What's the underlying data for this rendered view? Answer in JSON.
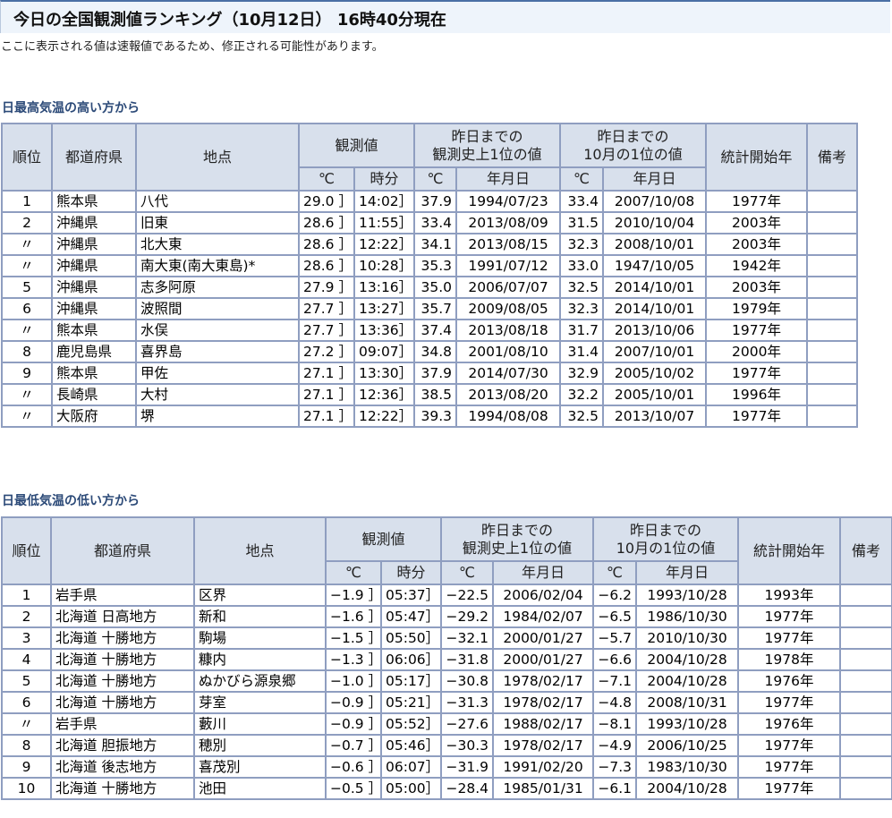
{
  "header": {
    "title": "今日の全国観測値ランキング（10月12日） 16時40分現在",
    "notice": "ここに表示される値は速報値であるため、修正される可能性があります。"
  },
  "columns": {
    "rank": "順位",
    "pref": "都道府県",
    "site": "地点",
    "obs": "観測値",
    "record_hist": "昨日まで の\n観測史上1位の値",
    "record_oct": "昨日まで の\n10月の1位の値",
    "stat_start": "統計開始年",
    "remarks": "備考",
    "celsius": "℃",
    "time": "時分",
    "date": "年月日"
  },
  "high": {
    "section_title": "日最高気温の高い方から",
    "rows": [
      [
        "1",
        "熊本県",
        "八代",
        "29.0 ］",
        "14:02］",
        "37.9",
        "1994/07/23",
        "33.4",
        "2007/10/08",
        "1977年",
        ""
      ],
      [
        "2",
        "沖縄県",
        "旧東",
        "28.6 ］",
        "11:55］",
        "33.4",
        "2013/08/09",
        "31.5",
        "2010/10/04",
        "2003年",
        ""
      ],
      [
        "〃",
        "沖縄県",
        "北大東",
        "28.6 ］",
        "12:22］",
        "34.1",
        "2013/08/15",
        "32.3",
        "2008/10/01",
        "2003年",
        ""
      ],
      [
        "〃",
        "沖縄県",
        "南大東(南大東島)*",
        "28.6 ］",
        "10:28］",
        "35.3",
        "1991/07/12",
        "33.0",
        "1947/10/05",
        "1942年",
        ""
      ],
      [
        "5",
        "沖縄県",
        "志多阿原",
        "27.9 ］",
        "13:16］",
        "35.0",
        "2006/07/07",
        "32.5",
        "2014/10/01",
        "2003年",
        ""
      ],
      [
        "6",
        "沖縄県",
        "波照間",
        "27.7 ］",
        "13:27］",
        "35.7",
        "2009/08/05",
        "32.3",
        "2014/10/01",
        "1979年",
        ""
      ],
      [
        "〃",
        "熊本県",
        "水俣",
        "27.7 ］",
        "13:36］",
        "37.4",
        "2013/08/18",
        "31.7",
        "2013/10/06",
        "1977年",
        ""
      ],
      [
        "8",
        "鹿児島県",
        "喜界島",
        "27.2 ］",
        "09:07］",
        "34.8",
        "2001/08/10",
        "31.4",
        "2007/10/01",
        "2000年",
        ""
      ],
      [
        "9",
        "熊本県",
        "甲佐",
        "27.1 ］",
        "13:30］",
        "37.9",
        "2014/07/30",
        "32.9",
        "2005/10/02",
        "1977年",
        ""
      ],
      [
        "〃",
        "長崎県",
        "大村",
        "27.1 ］",
        "12:36］",
        "38.5",
        "2013/08/20",
        "32.2",
        "2005/10/01",
        "1996年",
        ""
      ],
      [
        "〃",
        "大阪府",
        "堺",
        "27.1 ］",
        "12:22］",
        "39.3",
        "1994/08/08",
        "32.5",
        "2013/10/07",
        "1977年",
        ""
      ]
    ]
  },
  "low": {
    "section_title": "日最低気温の低い方から",
    "rows": [
      [
        "1",
        "岩手県",
        "区界",
        "−1.9 ］",
        "05:37］",
        "−22.5",
        "2006/02/04",
        "−6.2",
        "1993/10/28",
        "1993年",
        ""
      ],
      [
        "2",
        "北海道 日高地方",
        "新和",
        "−1.6 ］",
        "05:47］",
        "−29.2",
        "1984/02/07",
        "−6.5",
        "1986/10/30",
        "1977年",
        ""
      ],
      [
        "3",
        "北海道 十勝地方",
        "駒場",
        "−1.5 ］",
        "05:50］",
        "−32.1",
        "2000/01/27",
        "−5.7",
        "2010/10/30",
        "1977年",
        ""
      ],
      [
        "4",
        "北海道 十勝地方",
        "糠内",
        "−1.3 ］",
        "06:06］",
        "−31.8",
        "2000/01/27",
        "−6.6",
        "2004/10/28",
        "1978年",
        ""
      ],
      [
        "5",
        "北海道 十勝地方",
        "ぬかびら源泉郷",
        "−1.0 ］",
        "05:17］",
        "−30.8",
        "1978/02/17",
        "−7.1",
        "2004/10/28",
        "1976年",
        ""
      ],
      [
        "6",
        "北海道 十勝地方",
        "芽室",
        "−0.9 ］",
        "05:21］",
        "−31.3",
        "1978/02/17",
        "−4.8",
        "2008/10/31",
        "1977年",
        ""
      ],
      [
        "〃",
        "岩手県",
        "藪川",
        "−0.9 ］",
        "05:52］",
        "−27.6",
        "1988/02/17",
        "−8.1",
        "1993/10/28",
        "1976年",
        ""
      ],
      [
        "8",
        "北海道 胆振地方",
        "穂別",
        "−0.7 ］",
        "05:46］",
        "−30.3",
        "1978/02/17",
        "−4.9",
        "2006/10/25",
        "1977年",
        ""
      ],
      [
        "9",
        "北海道 後志地方",
        "喜茂別",
        "−0.6 ］",
        "06:07］",
        "−31.9",
        "1991/02/20",
        "−7.3",
        "1983/10/30",
        "1977年",
        ""
      ],
      [
        "10",
        "北海道 十勝地方",
        "池田",
        "−0.5 ］",
        "05:00］",
        "−28.4",
        "1985/01/31",
        "−6.1",
        "2004/10/28",
        "1977年",
        ""
      ]
    ]
  }
}
